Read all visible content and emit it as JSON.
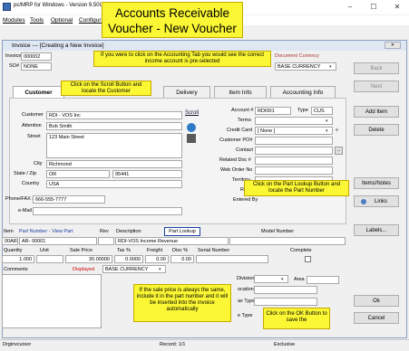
{
  "window": {
    "title": "pc/MRP for Windows - Version 9.50U",
    "menu": [
      "Modules",
      "Tools",
      "Optional",
      "Configura"
    ]
  },
  "banner": {
    "line1": "Accounts Receivable",
    "line2": "Voucher - New Voucher"
  },
  "invoice_window": {
    "title": "Invoice --- [Creating a New Invoice]",
    "invoice_label": "Invoice #",
    "invoice_value": "000002",
    "so_label": "SO#",
    "so_value": "NONE",
    "doc_currency_label": "Document Currency",
    "doc_currency_value": "BASE CURRENCY"
  },
  "tabs": [
    "Customer",
    "Delivery",
    "Item Info",
    "Accounting Info"
  ],
  "customer": {
    "customer_label": "Customer",
    "customer_value": "RDI - VOS Inc",
    "scroll_label": "Scroll",
    "attention_label": "Attention",
    "attention_value": "Bob Smith",
    "street_label": "Street",
    "street_value": "123 Main Street",
    "city_label": "City",
    "city_value": "Richmond",
    "state_label": "State / Zip",
    "state_value": "OR",
    "zip_value": "95441",
    "country_label": "Country",
    "country_value": "USA",
    "phone_label": "Phone/FAX #",
    "phone_value": "666-555-7777",
    "email_label": "e-Mail"
  },
  "accounting": {
    "account_label": "Account #",
    "account_value": "RDI001",
    "type_label": "Type",
    "type_value": "CUS",
    "terms_label": "Terms",
    "credit_label": "Credit Card",
    "credit_value": "[ None ]",
    "cust_po_label": "Customer PO#",
    "contact_label": "Contact",
    "related_label": "Related Doc #",
    "web_label": "Web Order No",
    "territory_label": "Territory",
    "region_label": "Regio",
    "entered_label": "Entered By"
  },
  "item_grid": {
    "item_label": "Item",
    "part_view_label": "Part Number - View Part",
    "rev_label": "Rev",
    "description_label": "Description",
    "part_lookup_label": "Part Lookup",
    "model_label": "Model Number",
    "item_value": "00AR",
    "part_value": "AR- 00001",
    "description_value": "RDI-VOS Income Revenue",
    "quantity_label": "Quantity",
    "unit_label": "Unit",
    "sale_price_label": "Sale Price",
    "tax_label": "Tax %",
    "freight_label": "Freight",
    "disc_label": "Disc %",
    "serial_label": "Serial Number",
    "complete_label": "Complete",
    "quantity_value": "1.000",
    "sale_price_value": "30.00000",
    "tax_value": "0.0000",
    "freight_value": "0.00",
    "disc_value": "0.00",
    "comments_label": "Comments",
    "displayed_label": "Displayed",
    "displayed_value": "BASE CURRENCY",
    "division_label": "Division",
    "area_label": "Area",
    "location_label": "ocation",
    "tax_type_label": "ax Type",
    "type2_label": "e Type"
  },
  "right_buttons": [
    "Back",
    "Next",
    "Add Item",
    "Delete",
    "Items/Notes",
    "Links",
    "Labels...",
    "Ok",
    "Cancel"
  ],
  "callouts": {
    "accounting_tab": "If you were to click on the Accounting Tab you would see the correct income account is pre-selected",
    "scroll_button": "Click on the Scroll Button and locate the Customer",
    "part_lookup": "Click on the Part Lookup Button and locate the Part Number",
    "sale_price": "If the sale price is always the same, include it in the part number and it will be inserted into the invoice automatically",
    "ok_button": "Click on the OK Button to save the"
  },
  "status": {
    "left": "Drginvcursor",
    "record": "Record: 1/1",
    "mode": "Exclusive"
  },
  "colors": {
    "callout": "#fbf734",
    "title_blue": "#dfe7f3"
  }
}
